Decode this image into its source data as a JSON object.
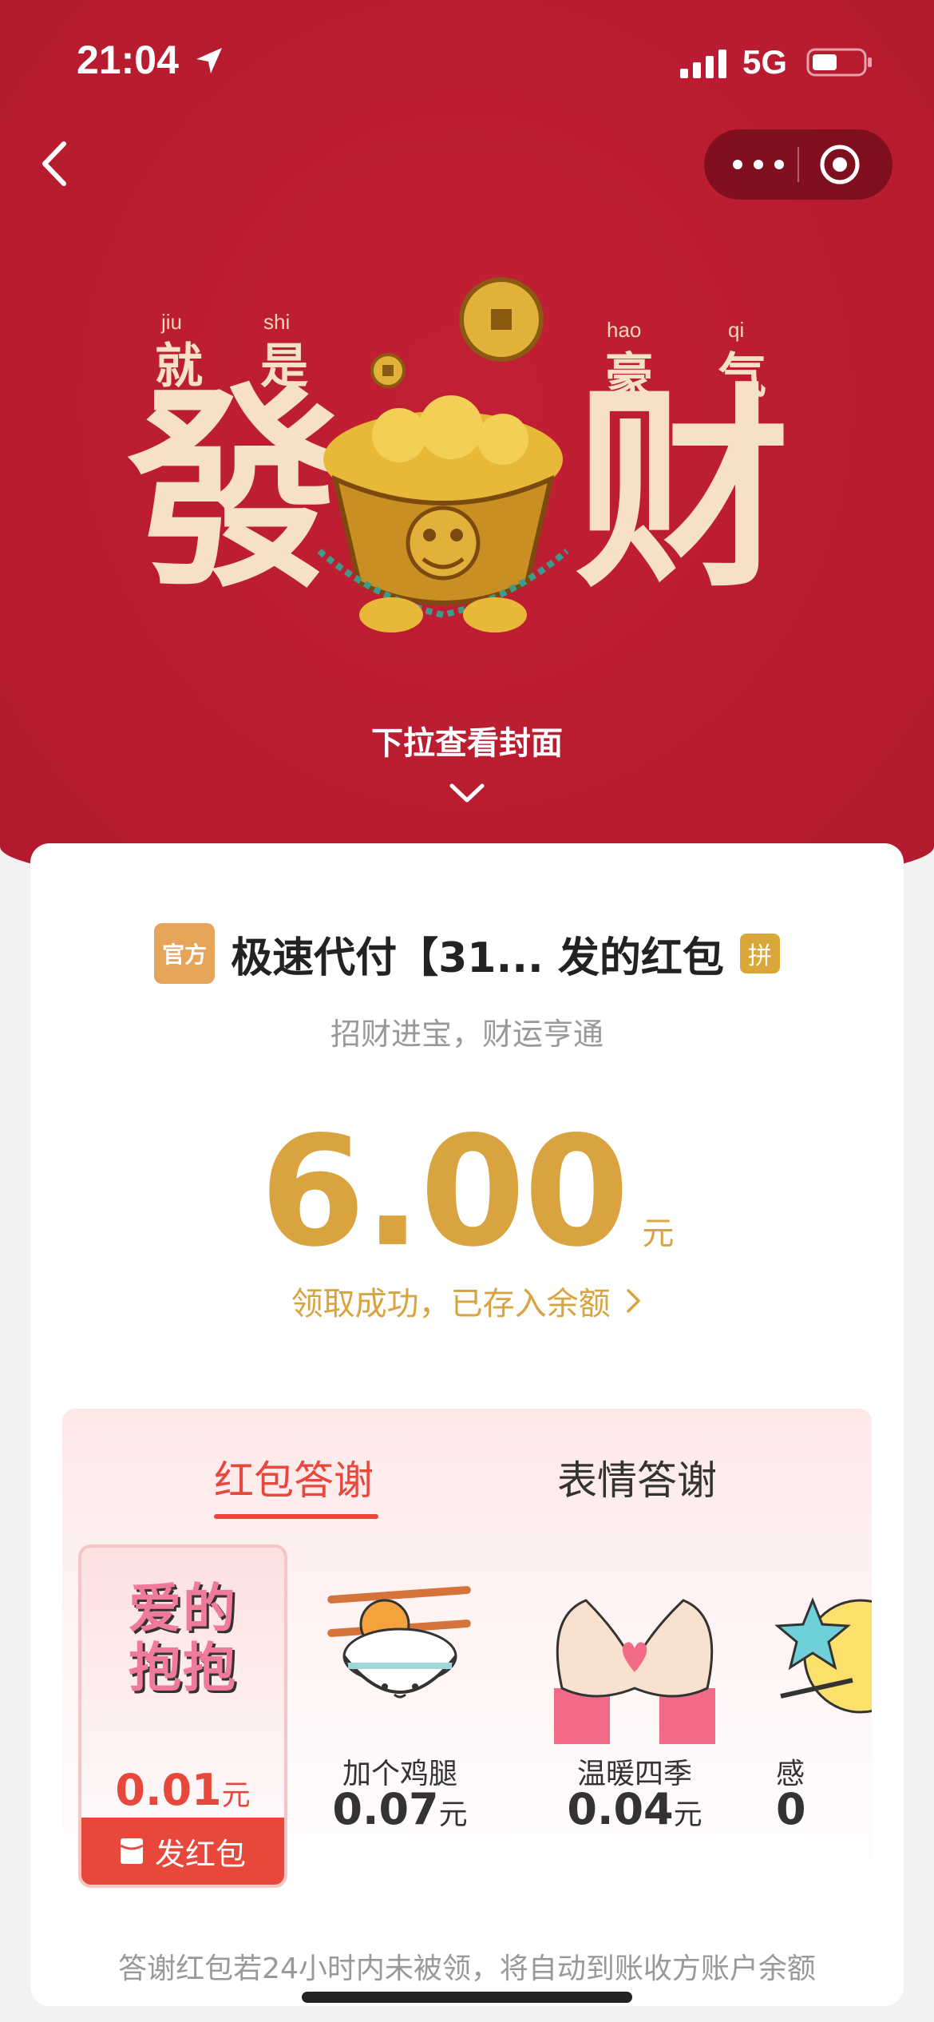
{
  "status_bar": {
    "time": "21:04",
    "network": "5G"
  },
  "cover": {
    "pinyin": [
      "jiu",
      "shi",
      "hao",
      "qi"
    ],
    "small_chars": [
      "就",
      "是",
      "豪",
      "气"
    ],
    "big_chars": [
      "發",
      "财"
    ],
    "pull_hint": "下拉查看封面"
  },
  "sender": {
    "avatar_text": "官方",
    "name": "极速代付【31... 发的红包",
    "badge": "拼"
  },
  "wish": "招财进宝，财运亨通",
  "amount": {
    "value": "6.00",
    "unit": "元"
  },
  "received_text": "领取成功，已存入余额",
  "tabs": [
    {
      "label": "红包答谢",
      "active": true
    },
    {
      "label": "表情答谢",
      "active": false
    }
  ],
  "items": [
    {
      "art_text": "爱的抱抱",
      "price": "0.01",
      "unit": "元",
      "selected": true,
      "action": "发红包"
    },
    {
      "name": "加个鸡腿",
      "price": "0.07",
      "unit": "元"
    },
    {
      "name": "温暖四季",
      "price": "0.04",
      "unit": "元"
    },
    {
      "name": "感",
      "price": "0"
    }
  ],
  "footnote": "答谢红包若24小时内未被领，将自动到账收方账户余额",
  "colors": {
    "header_red": "#b91c30",
    "gold": "#d9a440",
    "accent_red": "#e8473b"
  }
}
